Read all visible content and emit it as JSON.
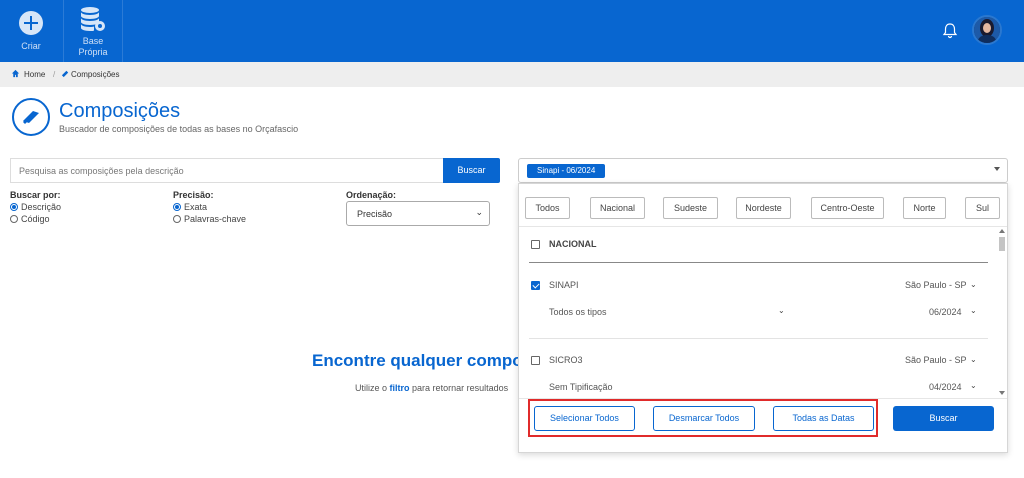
{
  "topbar": {
    "criar_label": "Criar",
    "base_label_line1": "Base",
    "base_label_line2": "Própria",
    "brand_color": "#0866d0"
  },
  "breadcrumb": {
    "home": "Home",
    "separator": "/",
    "current": "Composições"
  },
  "header": {
    "title": "Composições",
    "subtitle": "Buscador de composições de todas as bases no Orçafascio"
  },
  "search": {
    "placeholder": "Pesquisa as composições pela descrição",
    "button_label": "Buscar"
  },
  "filters": {
    "buscar_por_label": "Buscar por:",
    "buscar_por_options": [
      "Descrição",
      "Código"
    ],
    "buscar_por_selected": "Descrição",
    "precisao_label": "Precisão:",
    "precisao_options": [
      "Exata",
      "Palavras-chave"
    ],
    "precisao_selected": "Exata",
    "ordenacao_label": "Ordenação:",
    "ordenacao_value": "Precisão"
  },
  "empty_state": {
    "title": "Encontre qualquer compos",
    "sub_prefix": "Utilize o",
    "sub_link": "filtro",
    "sub_suffix": "para retornar resultados"
  },
  "base_select": {
    "selected_chip": "Sinapi - 06/2024"
  },
  "dropdown": {
    "regions": [
      "Todos",
      "Nacional",
      "Sudeste",
      "Nordeste",
      "Centro-Oeste",
      "Norte",
      "Sul"
    ],
    "group_header": "NACIONAL",
    "bases": [
      {
        "name": "SINAPI",
        "checked": true,
        "location": "São Paulo - SP",
        "type": "Todos os tipos",
        "date": "06/2024"
      },
      {
        "name": "SICRO3",
        "checked": false,
        "location": "São Paulo - SP",
        "type": "Sem Tipificação",
        "date": "04/2024"
      }
    ],
    "footer": {
      "select_all": "Selecionar Todos",
      "deselect_all": "Desmarcar Todos",
      "all_dates": "Todas as Datas",
      "search": "Buscar"
    }
  }
}
